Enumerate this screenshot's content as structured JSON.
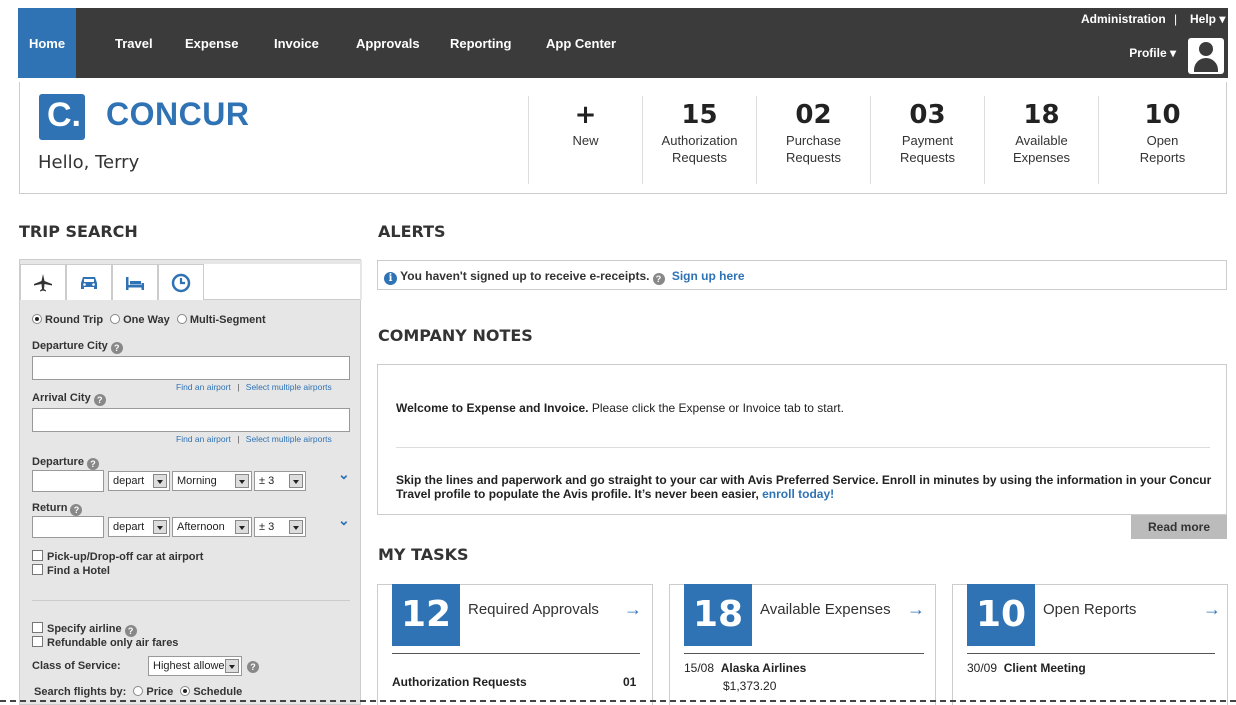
{
  "nav": {
    "tabs": [
      "Home",
      "Travel",
      "Expense",
      "Invoice",
      "Approvals",
      "Reporting",
      "App Center"
    ],
    "administration": "Administration",
    "separator": "|",
    "help": "Help ▾",
    "profile": "Profile ▾"
  },
  "header": {
    "logo_letter": "C.",
    "brand": "CONCUR",
    "greeting": "Hello, Terry",
    "stats": [
      {
        "num": "+",
        "label1": "New",
        "label2": ""
      },
      {
        "num": "15",
        "label1": "Authorization",
        "label2": "Requests"
      },
      {
        "num": "02",
        "label1": "Purchase",
        "label2": "Requests"
      },
      {
        "num": "03",
        "label1": "Payment",
        "label2": "Requests"
      },
      {
        "num": "18",
        "label1": "Available",
        "label2": "Expenses"
      },
      {
        "num": "10",
        "label1": "Open",
        "label2": "Reports"
      }
    ]
  },
  "trip": {
    "heading": "TRIP SEARCH",
    "round_trip": "Round Trip",
    "one_way": "One Way",
    "multi_segment": "Multi-Segment",
    "departure_city": "Departure City",
    "arrival_city": "Arrival City",
    "find_airport": "Find an airport",
    "link_sep": "|",
    "select_multiple": "Select multiple airports",
    "departure": "Departure",
    "return": "Return",
    "depart_option": "depart",
    "morning": "Morning",
    "afternoon": "Afternoon",
    "range": "± 3",
    "car_pickup": "Pick-up/Drop-off car at airport",
    "find_hotel": "Find a Hotel",
    "specify_airline": "Specify airline",
    "refundable": "Refundable only air fares",
    "class_label": "Class of Service:",
    "class_value": "Highest allowed",
    "search_by": "Search flights by:",
    "price": "Price",
    "schedule": "Schedule"
  },
  "alerts": {
    "heading": "ALERTS",
    "text": "You haven't signed up to receive e-receipts.",
    "link": "Sign up here"
  },
  "notes": {
    "heading": "COMPANY NOTES",
    "p1_bold": "Welcome to Expense and Invoice.",
    "p1_rest": " Please click the Expense or Invoice tab to start.",
    "p2": "Skip the lines and paperwork and go straight to your car with Avis Preferred Service. Enroll in minutes by using the information in your Concur Travel profile to populate the Avis profile.  It’s never been easier, ",
    "p2_link": "enroll today!",
    "read_more": "Read more"
  },
  "tasks": {
    "heading": "MY TASKS",
    "cards": [
      {
        "num": "12",
        "title": "Required Approvals",
        "row_left": "Authorization Requests",
        "row_right": "01",
        "row_sub": ""
      },
      {
        "num": "18",
        "title": "Available Expenses",
        "row_left": "15/08",
        "row_right": "Alaska Airlines",
        "row_sub": "$1,373.20"
      },
      {
        "num": "10",
        "title": "Open Reports",
        "row_left": "30/09",
        "row_right": "Client Meeting",
        "row_sub": ""
      }
    ]
  },
  "colors": {
    "accent": "#2f73b5",
    "nav_bg": "#3b3b3b",
    "panel_bg": "#e6e6e6"
  }
}
